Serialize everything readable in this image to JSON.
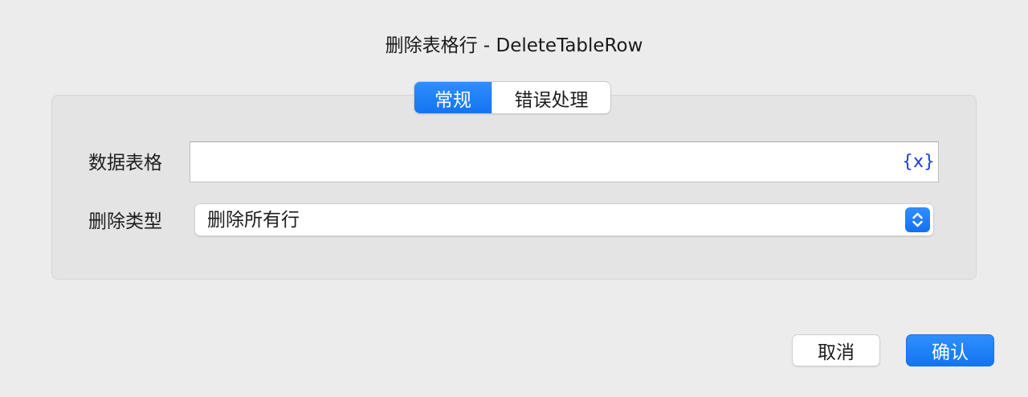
{
  "dialog": {
    "title": "删除表格行 - DeleteTableRow"
  },
  "tabs": [
    {
      "label": "常规",
      "active": true
    },
    {
      "label": "错误处理",
      "active": false
    }
  ],
  "form": {
    "data_table": {
      "label": "数据表格",
      "value": "",
      "variable_icon": "{x}"
    },
    "delete_type": {
      "label": "删除类型",
      "selected": "删除所有行"
    }
  },
  "buttons": {
    "cancel_label": "取消",
    "ok_label": "确认"
  },
  "colors": {
    "accent": "#1474f0",
    "variable_icon": "#1f3de0",
    "background": "#ececec",
    "group_box": "#e4e4e4"
  }
}
